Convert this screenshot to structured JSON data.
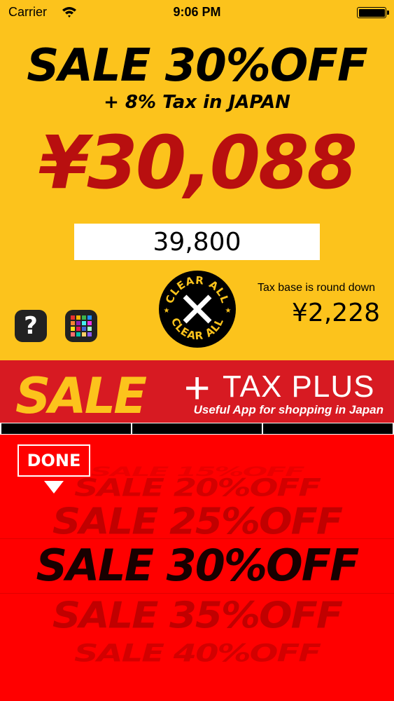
{
  "status_bar": {
    "carrier": "Carrier",
    "time": "9:06 PM"
  },
  "header": {
    "discount_label": "SALE 30%OFF",
    "tax_label": "+ 8% Tax in JAPAN",
    "total_price": "¥30,088"
  },
  "input": {
    "price_value": "39,800"
  },
  "clear_button": {
    "label_top": "CLEAR ALL",
    "label_bottom": "CLEAR ALL"
  },
  "tax_info": {
    "note": "Tax base is round down",
    "amount": "¥2,228"
  },
  "help_button": {
    "label": "?"
  },
  "apps_button": {
    "tile_colors": [
      "#e8312f",
      "#f7b500",
      "#3cb44b",
      "#1e90ff",
      "#f58231",
      "#911eb4",
      "#46f0f0",
      "#f032e6",
      "#ffe119",
      "#e6194b",
      "#4363d8",
      "#aaffc3",
      "#ff6b6b",
      "#00c2a8",
      "#ffd166",
      "#8d5cf6"
    ]
  },
  "banner": {
    "sale": "SALE",
    "plus": "+",
    "tax_plus": "TAX PLUS",
    "tagline": "Useful App for shopping in Japan"
  },
  "picker": {
    "rows": [
      {
        "label": "SALE 15%OFF"
      },
      {
        "label": "SALE 20%OFF"
      },
      {
        "label": "SALE 25%OFF"
      },
      {
        "label": "SALE 30%OFF",
        "selected": true
      },
      {
        "label": "SALE 35%OFF"
      },
      {
        "label": "SALE 40%OFF"
      }
    ],
    "done_label": "DONE"
  },
  "colors": {
    "yellow": "#fcc31c",
    "price_red": "#b80f0f",
    "picker_red": "#ff0000",
    "banner_red": "#d71a22"
  }
}
